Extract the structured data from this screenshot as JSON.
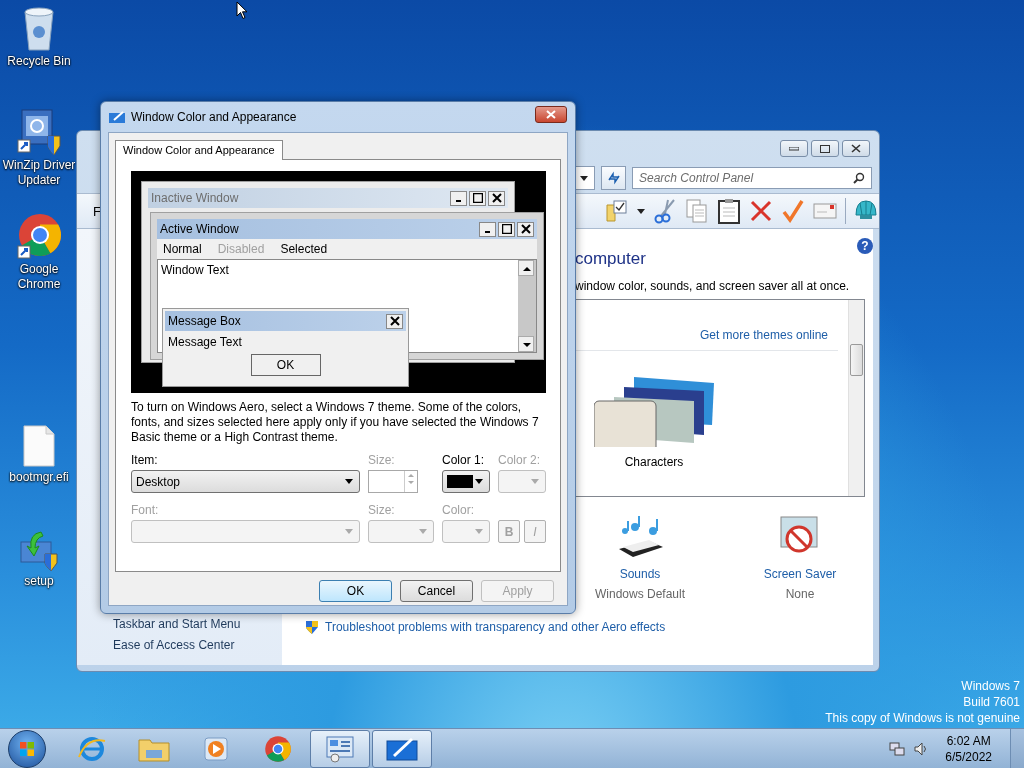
{
  "desktop": {
    "icons": [
      {
        "label": "Recycle Bin",
        "kind": "recycle-bin"
      },
      {
        "label": "WinZip Driver Updater",
        "kind": "driver-updater"
      },
      {
        "label": "Google Chrome",
        "kind": "chrome"
      },
      {
        "label": "bootmgr.efi",
        "kind": "file"
      },
      {
        "label": "setup",
        "kind": "setup"
      }
    ],
    "notice": [
      "Windows 7",
      "Build 7601",
      "This copy of Windows is not genuine"
    ]
  },
  "control_panel": {
    "menu_fragment": "F",
    "search": {
      "placeholder": "Search Control Panel"
    },
    "sidebar_links": [
      "Taskbar and Start Menu",
      "Ease of Access Center"
    ],
    "help_button": "?",
    "heading": "computer",
    "subtitle": "window color, sounds, and screen saver all at once.",
    "themes": {
      "link": "Get more themes online",
      "selected_theme": "Characters"
    },
    "settings": [
      {
        "label": "Sounds",
        "value": "Windows Default",
        "kind": "sounds"
      },
      {
        "label": "Screen Saver",
        "value": "None",
        "kind": "screen-saver"
      }
    ],
    "troubleshoot_link": "Troubleshoot problems with transparency and other Aero effects"
  },
  "dialog": {
    "title": "Window Color and Appearance",
    "tabs": [
      {
        "label": "Window Color and Appearance",
        "selected": true
      }
    ],
    "preview": {
      "inactive_title": "Inactive Window",
      "active_title": "Active Window",
      "menu": [
        {
          "label": "Normal",
          "disabled": false
        },
        {
          "label": "Disabled",
          "disabled": true
        },
        {
          "label": "Selected",
          "disabled": false
        }
      ],
      "window_text": "Window Text",
      "message_title": "Message Box",
      "message_text": "Message Text",
      "message_button": "OK"
    },
    "description": "To turn on Windows Aero, select a Windows 7 theme.  Some of the colors, fonts, and sizes selected here apply only if you have selected the Windows 7 Basic theme or a High Contrast theme.",
    "fields": [
      {
        "label": "Item:",
        "kind": "dropdown",
        "value": "Desktop",
        "disabled": false
      },
      {
        "label": "Size:",
        "kind": "spinner",
        "disabled": true
      },
      {
        "label": "Color 1:",
        "kind": "color",
        "color": "#000000",
        "disabled": false
      },
      {
        "label": "Color 2:",
        "kind": "color",
        "disabled": true
      },
      {
        "label": "Font:",
        "kind": "dropdown",
        "disabled": true
      },
      {
        "label": "Size:",
        "kind": "dropdown",
        "disabled": true
      },
      {
        "label": "Color:",
        "kind": "color",
        "disabled": true
      },
      {
        "kind": "style-buttons",
        "buttons": [
          {
            "label": "B",
            "disabled": true
          },
          {
            "label": "I",
            "disabled": true
          }
        ]
      }
    ],
    "buttons": [
      {
        "label": "OK",
        "default": true,
        "disabled": false
      },
      {
        "label": "Cancel",
        "default": false,
        "disabled": false
      },
      {
        "label": "Apply",
        "default": false,
        "disabled": true
      }
    ]
  },
  "taskbar": {
    "apps": [
      {
        "kind": "internet-explorer",
        "active": false
      },
      {
        "kind": "file-explorer",
        "active": false
      },
      {
        "kind": "media-player",
        "active": false
      },
      {
        "kind": "chrome",
        "active": false
      },
      {
        "kind": "control-panel",
        "active": true
      },
      {
        "kind": "appearance",
        "active": true
      }
    ],
    "clock": {
      "time": "6:02 AM",
      "date": "6/5/2022"
    }
  }
}
